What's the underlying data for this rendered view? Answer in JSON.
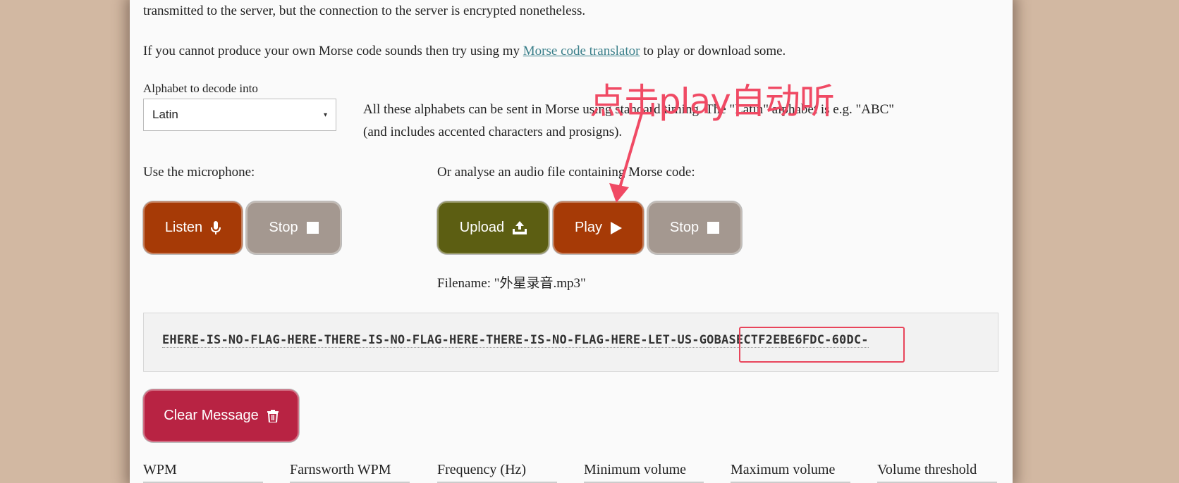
{
  "intro": {
    "line1": "transmitted to the server, but the connection to the server is encrypted nonetheless.",
    "line2_before": "If you cannot produce your own Morse code sounds then try using my ",
    "line2_link": "Morse code translator",
    "line2_after": " to play or download some."
  },
  "alphabet": {
    "label": "Alphabet to decode into",
    "selected": "Latin",
    "note_line1": "All these alphabets can be sent in Morse using standard timing. The \"Latin\" alphabet is e.g. \"ABC\"",
    "note_line2": "(and includes accented characters and prosigns)."
  },
  "microphone": {
    "heading": "Use the microphone:",
    "listen_label": "Listen",
    "stop_label": "Stop"
  },
  "audio_file": {
    "heading": "Or analyse an audio file containing Morse code:",
    "upload_label": "Upload",
    "play_label": "Play",
    "stop_label": "Stop",
    "filename": "Filename: \"外星录音.mp3\""
  },
  "output": {
    "text": "EHERE-IS-NO-FLAG-HERE-THERE-IS-NO-FLAG-HERE-THERE-IS-NO-FLAG-HERE-LET-US-GOBASECTF2EBE6FDC-60DC-"
  },
  "clear_button_label": "Clear Message",
  "annotation_text": "点击play自动听",
  "settings": {
    "wpm": "WPM",
    "farnsworth": "Farnsworth WPM",
    "frequency": "Frequency (Hz)",
    "min_volume": "Minimum volume",
    "max_volume": "Maximum volume",
    "threshold": "Volume threshold"
  },
  "colors": {
    "background": "#d2b8a2",
    "button_orange": "#a63a06",
    "button_grey": "#a49890",
    "button_olive": "#5c5e12",
    "button_red": "#b82343",
    "annotation": "#f04a64",
    "link": "#3a7f8a"
  }
}
